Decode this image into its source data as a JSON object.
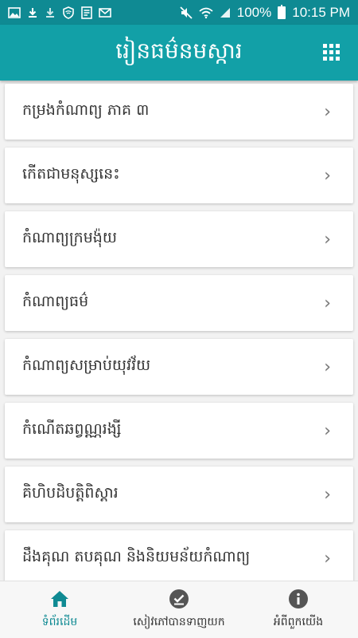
{
  "status_bar": {
    "battery": "100%",
    "time": "10:15 PM",
    "left_icons": [
      "image-icon",
      "download-icon",
      "download-done-icon",
      "shield-icon",
      "document-icon",
      "mail-icon"
    ],
    "right_icons": [
      "mute-icon",
      "wifi-icon",
      "signal-icon",
      "battery-icon"
    ]
  },
  "app_bar": {
    "title": "រៀនធម៌នមស្ការ",
    "menu_icon": "grid-icon"
  },
  "list": {
    "items": [
      {
        "label": "កម្រងកំណាព្យ ភាគ ៣"
      },
      {
        "label": "កើតជាមនុស្សនេះ"
      },
      {
        "label": "កំណាព្យក្រមង៉ុយ"
      },
      {
        "label": "កំណាព្យធម៌"
      },
      {
        "label": "កំណាព្យសម្រាប់យុវវ័យ"
      },
      {
        "label": "កំណើតឆព្វណ្ណរង្សី"
      },
      {
        "label": "គិហិបដិបត្តិពិស្តារ"
      },
      {
        "label": "ដឹងគុណ តបគុណ និងនិយមន័យកំណាព្យ"
      }
    ]
  },
  "bottom_nav": {
    "items": [
      {
        "label": "ទំព័រដើម",
        "icon": "home-icon",
        "active": true
      },
      {
        "label": "សៀវភៅបានទាញយក",
        "icon": "download-check-icon",
        "active": false
      },
      {
        "label": "អំពីពួកយើង",
        "icon": "info-icon",
        "active": false
      }
    ]
  },
  "colors": {
    "status_bar": "#0f8a93",
    "app_bar": "#12a0a7",
    "active_tab": "#0f8a93"
  }
}
